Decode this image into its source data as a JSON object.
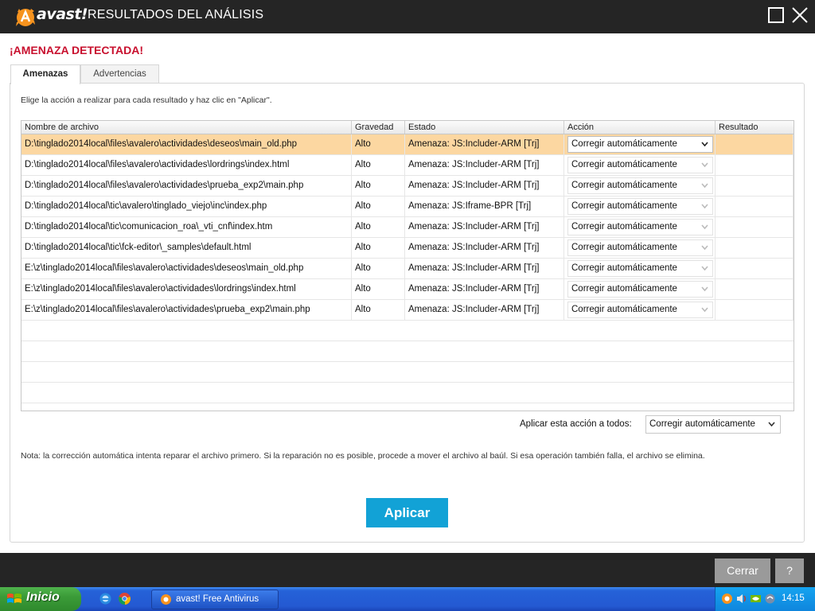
{
  "window": {
    "brand": "avast!",
    "title": "RESULTADOS DEL ANÁLISIS"
  },
  "heading": "¡AMENAZA DETECTADA!",
  "tabs": [
    {
      "label": "Amenazas",
      "active": true
    },
    {
      "label": "Advertencias",
      "active": false
    }
  ],
  "instruction": "Elige la acción a realizar para cada resultado y haz clic en \"Aplicar\".",
  "table": {
    "columns": [
      "Nombre de archivo",
      "Gravedad",
      "Estado",
      "Acción",
      "Resultado"
    ],
    "rows": [
      {
        "file": "D:\\tinglado2014local\\files\\avalero\\actividades\\deseos\\main_old.php",
        "severity": "Alto",
        "status": "Amenaza: JS:Includer-ARM [Trj]",
        "action": "Corregir automáticamente",
        "result": ""
      },
      {
        "file": "D:\\tinglado2014local\\files\\avalero\\actividades\\lordrings\\index.html",
        "severity": "Alto",
        "status": "Amenaza: JS:Includer-ARM [Trj]",
        "action": "Corregir automáticamente",
        "result": ""
      },
      {
        "file": "D:\\tinglado2014local\\files\\avalero\\actividades\\prueba_exp2\\main.php",
        "severity": "Alto",
        "status": "Amenaza: JS:Includer-ARM [Trj]",
        "action": "Corregir automáticamente",
        "result": ""
      },
      {
        "file": "D:\\tinglado2014local\\tic\\avalero\\tinglado_viejo\\inc\\index.php",
        "severity": "Alto",
        "status": "Amenaza: JS:Iframe-BPR [Trj]",
        "action": "Corregir automáticamente",
        "result": ""
      },
      {
        "file": "D:\\tinglado2014local\\tic\\comunicacion_roa\\_vti_cnf\\index.htm",
        "severity": "Alto",
        "status": "Amenaza: JS:Includer-ARM [Trj]",
        "action": "Corregir automáticamente",
        "result": ""
      },
      {
        "file": "D:\\tinglado2014local\\tic\\fck-editor\\_samples\\default.html",
        "severity": "Alto",
        "status": "Amenaza: JS:Includer-ARM [Trj]",
        "action": "Corregir automáticamente",
        "result": ""
      },
      {
        "file": "E:\\z\\tinglado2014local\\files\\avalero\\actividades\\deseos\\main_old.php",
        "severity": "Alto",
        "status": "Amenaza: JS:Includer-ARM [Trj]",
        "action": "Corregir automáticamente",
        "result": ""
      },
      {
        "file": "E:\\z\\tinglado2014local\\files\\avalero\\actividades\\lordrings\\index.html",
        "severity": "Alto",
        "status": "Amenaza: JS:Includer-ARM [Trj]",
        "action": "Corregir automáticamente",
        "result": ""
      },
      {
        "file": "E:\\z\\tinglado2014local\\files\\avalero\\actividades\\prueba_exp2\\main.php",
        "severity": "Alto",
        "status": "Amenaza: JS:Includer-ARM [Trj]",
        "action": "Corregir automáticamente",
        "result": ""
      }
    ]
  },
  "apply_all": {
    "label": "Aplicar esta acción a todos:",
    "value": "Corregir automáticamente"
  },
  "note": "Nota: la corrección automática intenta reparar el archivo primero. Si la reparación no es posible, procede a mover el archivo al baúl. Si esa operación también falla, el archivo se elimina.",
  "buttons": {
    "apply": "Aplicar",
    "close": "Cerrar",
    "help": "?"
  },
  "taskbar": {
    "start": "Inicio",
    "task": "avast! Free Antivirus",
    "clock": "14:15"
  },
  "colors": {
    "heading": "#c8102e",
    "selected_row": "#fcd7a1",
    "apply_button": "#12a2d6",
    "titlebar": "#252525",
    "brand_orange": "#f7931e"
  }
}
